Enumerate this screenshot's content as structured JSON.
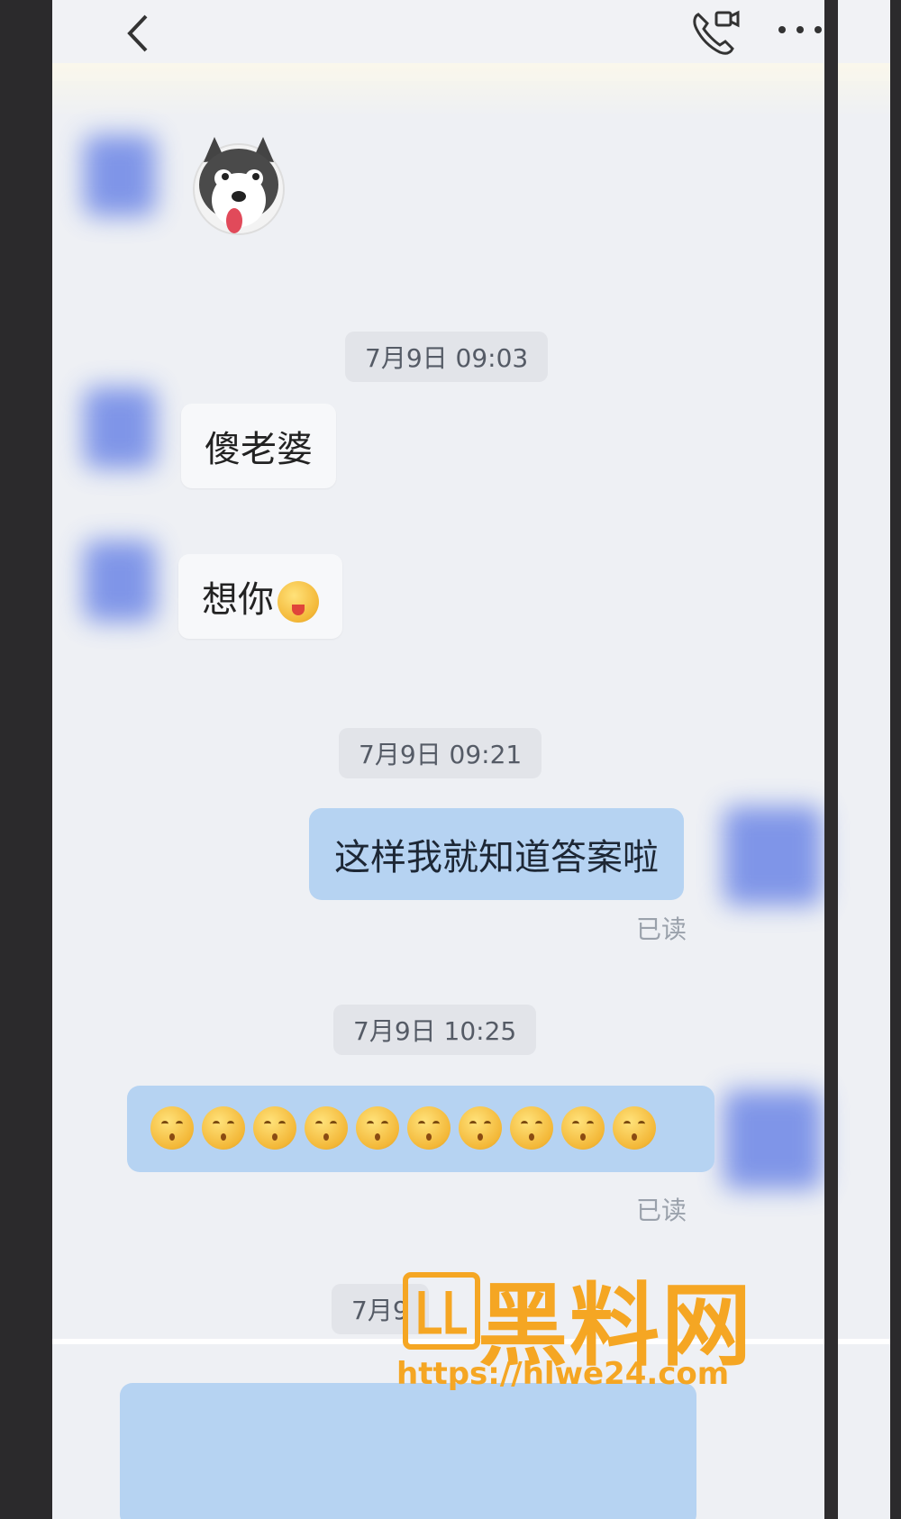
{
  "header": {
    "back_icon": "chevron-left-icon",
    "call_icon": "phone-video-icon",
    "more_icon": "more-dots-icon"
  },
  "messages": [
    {
      "type": "sticker",
      "side": "in",
      "sticker": "husky-dog-sticker"
    },
    {
      "type": "time",
      "text": "7月9日 09:03"
    },
    {
      "type": "text",
      "side": "in",
      "text": "傻老婆"
    },
    {
      "type": "text",
      "side": "in",
      "text": "想你",
      "emoji": "tongue-out-emoji"
    },
    {
      "type": "time",
      "text": "7月9日 09:21"
    },
    {
      "type": "text",
      "side": "out",
      "text": "这样我就知道答案啦",
      "status": "已读"
    },
    {
      "type": "time",
      "text": "7月9日 10:25"
    },
    {
      "type": "emoji-row",
      "side": "out",
      "emoji": "kissing-face-emoji",
      "count": 10,
      "status": "已读"
    },
    {
      "type": "time",
      "text": "7月9"
    }
  ],
  "watermark": {
    "title": "黑料网",
    "url": "https://hlwe24.com"
  },
  "colors": {
    "outgoing_bubble": "#b6d3f2",
    "incoming_bubble": "#f7f8fa",
    "background": "#eef0f4",
    "watermark": "#f5a623"
  }
}
